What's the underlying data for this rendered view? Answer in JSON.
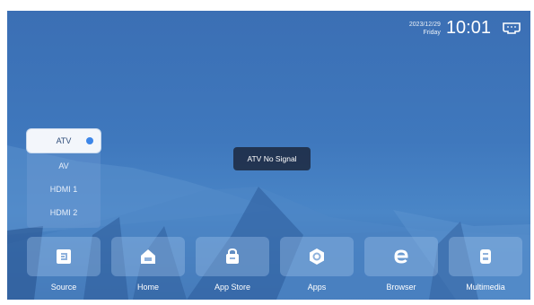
{
  "status_bar": {
    "date": "2023/12/29",
    "weekday": "Friday",
    "time": "10:01",
    "network_icon": "ethernet-icon"
  },
  "source_menu": {
    "items": [
      {
        "label": "ATV",
        "selected": true
      },
      {
        "label": "AV"
      },
      {
        "label": "HDMI 1"
      },
      {
        "label": "HDMI 2"
      }
    ]
  },
  "toast": {
    "message": "ATV No Signal"
  },
  "dock": {
    "items": [
      {
        "label": "Source",
        "icon": "source-icon"
      },
      {
        "label": "Home",
        "icon": "home-icon"
      },
      {
        "label": "App Store",
        "icon": "app-store-icon"
      },
      {
        "label": "Apps",
        "icon": "apps-icon"
      },
      {
        "label": "Browser",
        "icon": "browser-icon"
      },
      {
        "label": "Multimedia",
        "icon": "multimedia-icon"
      }
    ]
  },
  "colors": {
    "background": "#3f78bd",
    "accent": "#3d86e8",
    "toast_bg": "#1c283e"
  }
}
